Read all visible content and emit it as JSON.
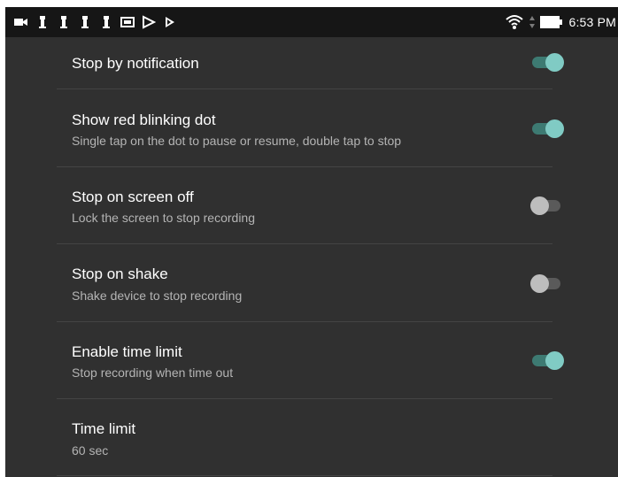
{
  "status_bar": {
    "time": "6:53 PM",
    "icons_left": [
      "video-camera-icon",
      "figure-icon",
      "figure-icon",
      "figure-icon",
      "figure-icon",
      "screen-icon",
      "flag-icon",
      "play-icon"
    ],
    "icons_right": [
      "wifi-icon",
      "data-arrows-icon",
      "battery-icon"
    ]
  },
  "settings": [
    {
      "title": "Stop by notification",
      "subtitle": "",
      "toggle": true
    },
    {
      "title": "Show red blinking dot",
      "subtitle": "Single tap on the dot to pause or resume, double tap to stop",
      "toggle": true
    },
    {
      "title": "Stop on screen off",
      "subtitle": "Lock the screen to stop recording",
      "toggle": false
    },
    {
      "title": "Stop on shake",
      "subtitle": "Shake device to stop recording",
      "toggle": false
    },
    {
      "title": "Enable time limit",
      "subtitle": "Stop recording when time out",
      "toggle": true
    },
    {
      "title": "Time limit",
      "subtitle": "60 sec"
    }
  ],
  "colors": {
    "background": "#303030",
    "status_bar": "#161616",
    "toggle_on_thumb": "#80cbc4",
    "toggle_on_track": "#3d7a72",
    "toggle_off_thumb": "#bdbdbd",
    "toggle_off_track": "#5a5a5a"
  }
}
